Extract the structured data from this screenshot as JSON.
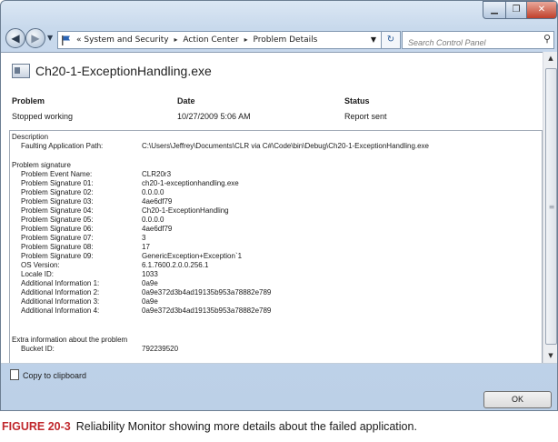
{
  "window": {
    "controls": {
      "minimize": "▁",
      "maximize": "❐",
      "close": "✕"
    }
  },
  "nav": {
    "back": "◀",
    "forward": "▶",
    "address_overflow": "«",
    "breadcrumbs": [
      "System and Security",
      "Action Center",
      "Problem Details"
    ],
    "breadcrumb_sep": "▸",
    "refresh": "↻",
    "search_placeholder": "Search Control Panel"
  },
  "app": {
    "title": "Ch20-1-ExceptionHandling.exe"
  },
  "summary": {
    "headers": {
      "problem": "Problem",
      "date": "Date",
      "status": "Status"
    },
    "values": {
      "problem": "Stopped working",
      "date": "10/27/2009 5:06 AM",
      "status": "Report sent"
    }
  },
  "details": {
    "description_heading": "Description",
    "faulting_label": "Faulting Application Path:",
    "faulting_value": "C:\\Users\\Jeffrey\\Documents\\CLR via C#\\Code\\bin\\Debug\\Ch20-1-ExceptionHandling.exe",
    "signature_heading": "Problem signature",
    "signature": [
      {
        "label": "Problem Event Name:",
        "value": "CLR20r3"
      },
      {
        "label": "Problem Signature 01:",
        "value": "ch20-1-exceptionhandling.exe"
      },
      {
        "label": "Problem Signature 02:",
        "value": "0.0.0.0"
      },
      {
        "label": "Problem Signature 03:",
        "value": "4ae6df79"
      },
      {
        "label": "Problem Signature 04:",
        "value": "Ch20-1-ExceptionHandling"
      },
      {
        "label": "Problem Signature 05:",
        "value": "0.0.0.0"
      },
      {
        "label": "Problem Signature 06:",
        "value": "4ae6df79"
      },
      {
        "label": "Problem Signature 07:",
        "value": "3"
      },
      {
        "label": "Problem Signature 08:",
        "value": "17"
      },
      {
        "label": "Problem Signature 09:",
        "value": "GenericException+Exception`1"
      },
      {
        "label": "OS Version:",
        "value": "6.1.7600.2.0.0.256.1"
      },
      {
        "label": "Locale ID:",
        "value": "1033"
      },
      {
        "label": "Additional Information 1:",
        "value": "0a9e"
      },
      {
        "label": "Additional Information 2:",
        "value": "0a9e372d3b4ad19135b953a78882e789"
      },
      {
        "label": "Additional Information 3:",
        "value": "0a9e"
      },
      {
        "label": "Additional Information 4:",
        "value": "0a9e372d3b4ad19135b953a78882e789"
      }
    ],
    "extra_heading": "Extra information about the problem",
    "bucket_label": "Bucket ID:",
    "bucket_value": "792239520"
  },
  "footer": {
    "copy_label": "Copy to clipboard",
    "ok_label": "OK"
  },
  "caption": {
    "label": "FIGURE 20-3",
    "text": "Reliability Monitor showing more details about the failed application."
  }
}
